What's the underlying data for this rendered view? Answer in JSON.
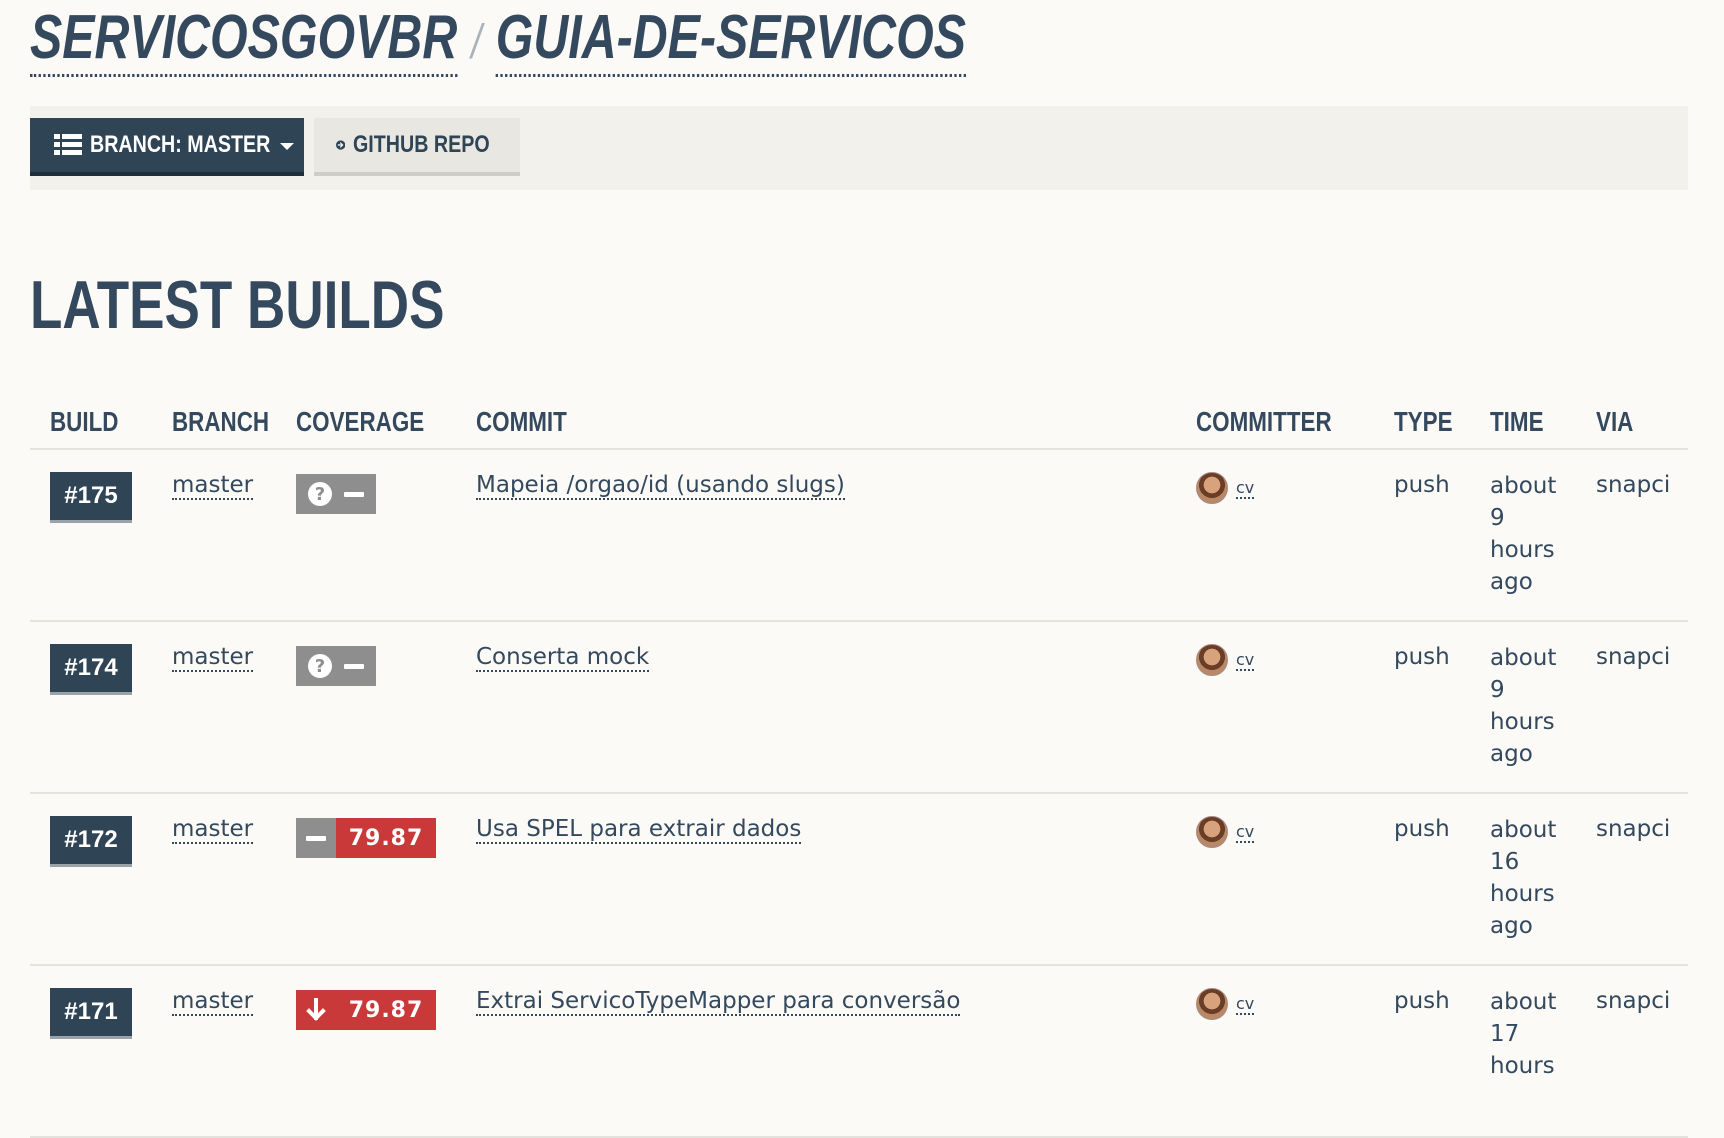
{
  "repo": {
    "owner": "SERVICOSGOVBR",
    "separator": "/",
    "name": "GUIA-DE-SERVICOS"
  },
  "toolbar": {
    "branch_label": "BRANCH: MASTER",
    "github_label": "GITHUB REPO"
  },
  "section_title": "LATEST BUILDS",
  "table": {
    "headers": {
      "build": "BUILD",
      "branch": "BRANCH",
      "coverage": "COVERAGE",
      "commit": "COMMIT",
      "committer": "COMMITTER",
      "type": "TYPE",
      "time": "TIME",
      "via": "VIA"
    },
    "rows": [
      {
        "build": "#175",
        "branch": "master",
        "coverage_state": "unknown",
        "coverage": "",
        "commit": "Mapeia /orgao/id (usando slugs)",
        "committer": "cv",
        "type": "push",
        "time": "about 9 hours ago",
        "via": "snapci"
      },
      {
        "build": "#174",
        "branch": "master",
        "coverage_state": "unknown",
        "coverage": "",
        "commit": "Conserta mock",
        "committer": "cv",
        "type": "push",
        "time": "about 9 hours ago",
        "via": "snapci"
      },
      {
        "build": "#172",
        "branch": "master",
        "coverage_state": "unchanged",
        "coverage": "79.87",
        "commit": "Usa SPEL para extrair dados",
        "committer": "cv",
        "type": "push",
        "time": "about 16 hours ago",
        "via": "snapci"
      },
      {
        "build": "#171",
        "branch": "master",
        "coverage_state": "decreased",
        "coverage": "79.87",
        "commit": "Extrai ServicoTypeMapper para conversão",
        "committer": "cv",
        "type": "push",
        "time": "about 17 hours",
        "via": "snapci"
      }
    ]
  },
  "colors": {
    "primary": "#2f4556",
    "coverage_bad": "#c9393a",
    "coverage_unknown": "#8e8e8e",
    "background": "#fbfaf6"
  }
}
